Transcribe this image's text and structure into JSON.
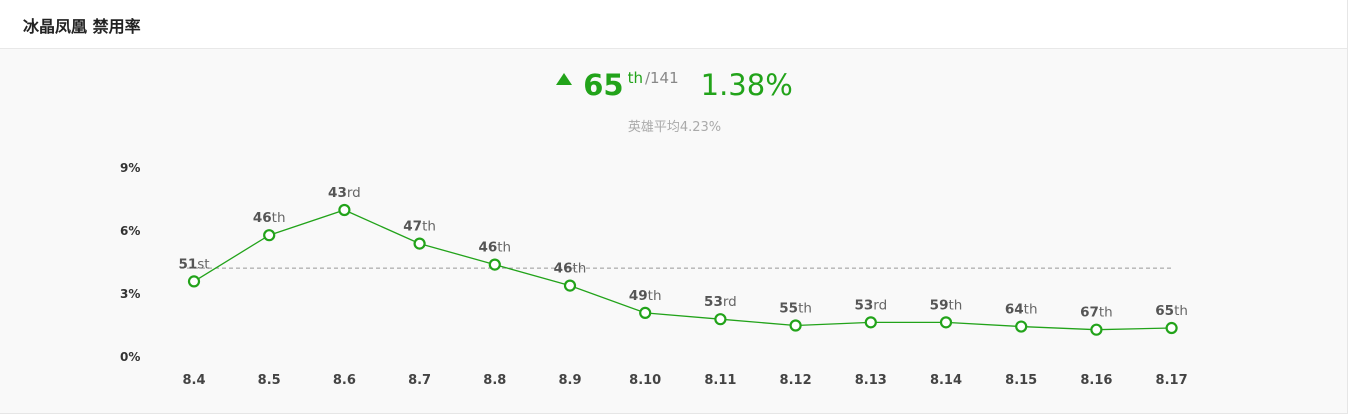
{
  "header": {
    "title": "冰晶凤凰 禁用率"
  },
  "summary": {
    "trend_icon": "triangle-up-icon",
    "rank": "65",
    "rank_suffix": "th",
    "rank_total": "/141",
    "ban_rate": "1.38%",
    "average_text": "英雄平均4.23%"
  },
  "colors": {
    "accent": "#22a31a",
    "line": "#22a31a",
    "average_line": "#999999"
  },
  "chart_data": {
    "type": "line",
    "categories": [
      "8.4",
      "8.5",
      "8.6",
      "8.7",
      "8.8",
      "8.9",
      "8.10",
      "8.11",
      "8.12",
      "8.13",
      "8.14",
      "8.15",
      "8.16",
      "8.17"
    ],
    "values": [
      3.6,
      5.8,
      7.0,
      5.4,
      4.4,
      3.4,
      2.1,
      1.8,
      1.5,
      1.65,
      1.65,
      1.45,
      1.3,
      1.38
    ],
    "point_labels": [
      {
        "num": "51",
        "suffix": "st"
      },
      {
        "num": "46",
        "suffix": "th"
      },
      {
        "num": "43",
        "suffix": "rd"
      },
      {
        "num": "47",
        "suffix": "th"
      },
      {
        "num": "46",
        "suffix": "th"
      },
      {
        "num": "46",
        "suffix": "th"
      },
      {
        "num": "49",
        "suffix": "th"
      },
      {
        "num": "53",
        "suffix": "rd"
      },
      {
        "num": "55",
        "suffix": "th"
      },
      {
        "num": "53",
        "suffix": "rd"
      },
      {
        "num": "59",
        "suffix": "th"
      },
      {
        "num": "64",
        "suffix": "th"
      },
      {
        "num": "67",
        "suffix": "th"
      },
      {
        "num": "65",
        "suffix": "th"
      }
    ],
    "average": 4.23,
    "yticks": [
      0,
      3,
      6,
      9
    ],
    "ytick_labels": [
      "0%",
      "3%",
      "6%",
      "9%"
    ],
    "ylim": [
      0,
      9
    ],
    "title": "",
    "xlabel": "",
    "ylabel": "",
    "legend": "none",
    "grid": false
  }
}
